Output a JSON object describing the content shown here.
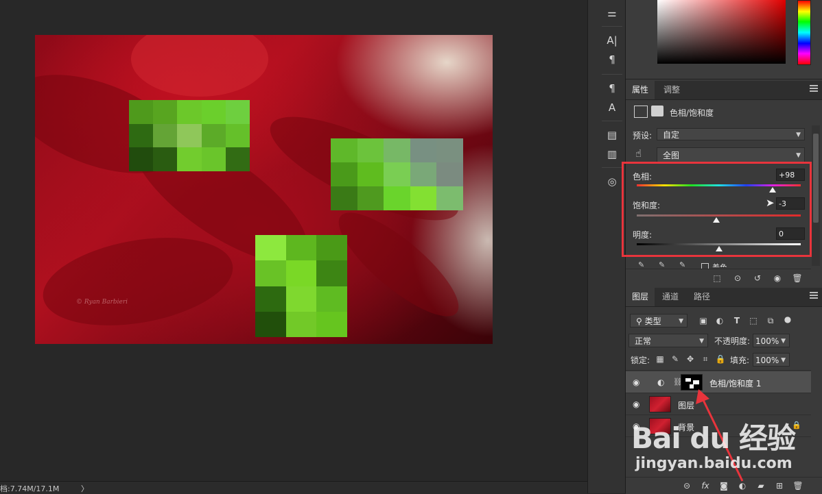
{
  "statusbar": {
    "doc_size": "档:7.74M/17.1M",
    "arrow": "〉"
  },
  "photo": {
    "signature": "© Ryan Barbieri"
  },
  "tools": [
    "adjust-panel-icon",
    "character-icon",
    "paragraph-icon",
    "paragraph-style-icon",
    "character-style-icon",
    "notes-icon",
    "history-icon",
    "brush-settings-icon"
  ],
  "properties": {
    "tabs": [
      {
        "label": "属性",
        "active": true
      },
      {
        "label": "调整",
        "active": false
      }
    ],
    "header_title": "色相/饱和度",
    "preset_label": "预设:",
    "preset_value": "自定",
    "channel_value": "全图",
    "hue": {
      "label": "色相:",
      "value": "+98",
      "position": 0.83
    },
    "saturation": {
      "label": "饱和度:",
      "value": "-3",
      "position": 0.485
    },
    "lightness": {
      "label": "明度:",
      "value": "0",
      "position": 0.5
    },
    "colorize_label": "着色"
  },
  "layers": {
    "tabs": [
      {
        "label": "图层",
        "active": true
      },
      {
        "label": "通道",
        "active": false
      },
      {
        "label": "路径",
        "active": false
      }
    ],
    "filter_value": "类型",
    "blend_mode": "正常",
    "opacity_label": "不透明度:",
    "opacity_value": "100%",
    "lock_label": "锁定:",
    "fill_label": "填充:",
    "fill_value": "100%",
    "items": [
      {
        "name": "色相/饱和度 1",
        "selected": true,
        "type": "adjustment"
      },
      {
        "name": "图层",
        "selected": false,
        "type": "image"
      },
      {
        "name": "背景",
        "selected": false,
        "type": "background"
      }
    ]
  },
  "watermark": {
    "logo": "Bai du 经验",
    "url": "jingyan.baidu.com"
  },
  "colors": {
    "highlight_red": "#e8343c",
    "panel_bg": "#3a3a3a",
    "canvas_bg": "#282828"
  }
}
